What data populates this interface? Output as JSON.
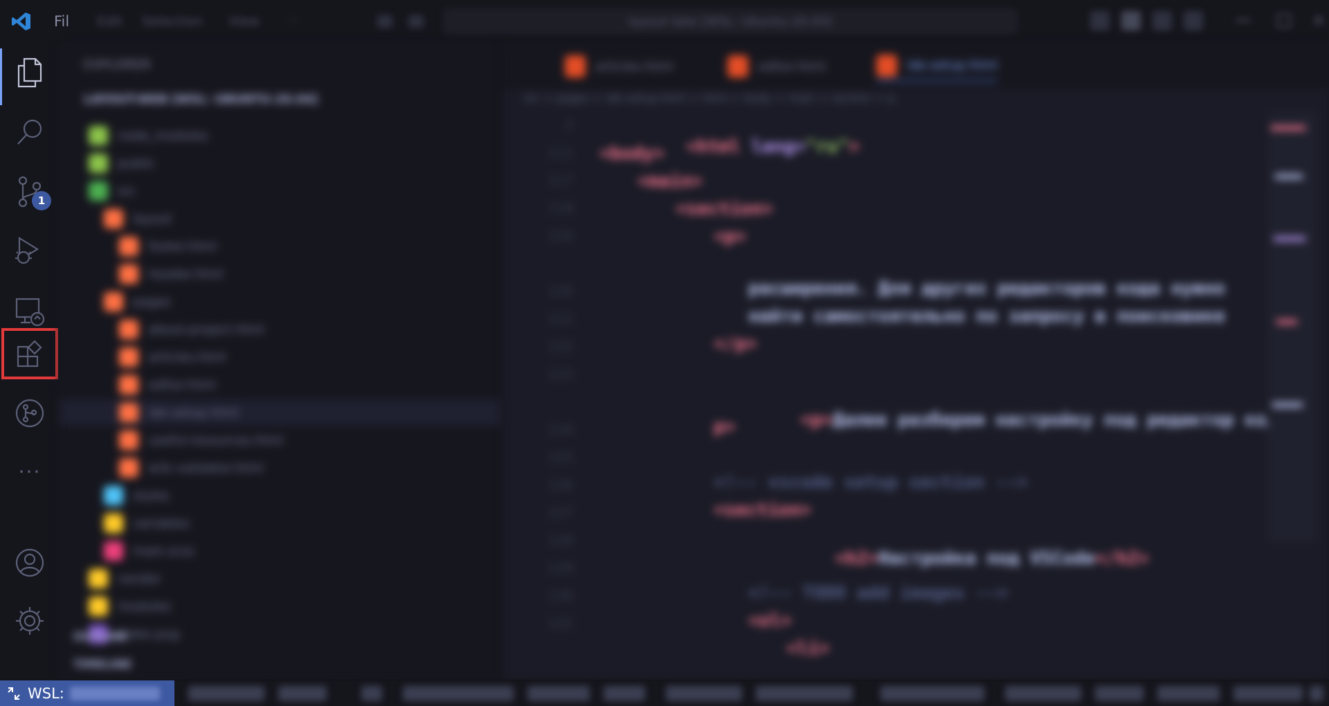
{
  "titlebar": {
    "menu_file": "Fil",
    "menu_edit": "Edit",
    "menu_selection": "Selection",
    "menu_view": "View",
    "menu_more": "···",
    "command_center": "layout-lake [WSL: Ubuntu-20.04]"
  },
  "activitybar": {
    "items": [
      {
        "name": "explorer"
      },
      {
        "name": "search"
      },
      {
        "name": "source-control",
        "badge": "1"
      },
      {
        "name": "run-and-debug"
      },
      {
        "name": "remote-explorer"
      },
      {
        "name": "extensions"
      },
      {
        "name": "git-graph"
      },
      {
        "name": "more"
      }
    ],
    "bottom": [
      {
        "name": "accounts"
      },
      {
        "name": "manage"
      }
    ]
  },
  "sidebar": {
    "title": "EXPLORER",
    "root": "LAYOUT-WEB [WSL: UBUNTU-20.04]",
    "tree": [
      {
        "label": "node_modules",
        "indent": 1,
        "color": "#8bc34a"
      },
      {
        "label": "public",
        "indent": 1,
        "color": "#8bc34a"
      },
      {
        "label": "src",
        "indent": 1,
        "color": "#4caf50"
      },
      {
        "label": "layout",
        "indent": 2,
        "color": "#ff7043"
      },
      {
        "label": "footer.html",
        "indent": 3,
        "color": "#ff7043"
      },
      {
        "label": "header.html",
        "indent": 3,
        "color": "#ff7043"
      },
      {
        "label": "pages",
        "indent": 2,
        "color": "#ff7043"
      },
      {
        "label": "about-project.html",
        "indent": 3,
        "color": "#ff7043"
      },
      {
        "label": "articles.html",
        "indent": 3,
        "color": "#ff7043"
      },
      {
        "label": "editor.html",
        "indent": 3,
        "color": "#ff7043"
      },
      {
        "label": "ide-setup.html",
        "indent": 3,
        "color": "#ff7043",
        "selected": true
      },
      {
        "label": "useful-resources.html",
        "indent": 3,
        "color": "#ff7043"
      },
      {
        "label": "w3c-validator.html",
        "indent": 3,
        "color": "#ff7043"
      },
      {
        "label": "styles",
        "indent": 2,
        "color": "#4fc3f7"
      },
      {
        "label": "variables",
        "indent": 2,
        "color": "#ffca28"
      },
      {
        "label": "main.scss",
        "indent": 2,
        "color": "#ec407a"
      },
      {
        "label": "vendor",
        "indent": 1,
        "color": "#ffca28"
      },
      {
        "label": "modules",
        "indent": 1,
        "color": "#ffca28"
      },
      {
        "label": "index.pug",
        "indent": 1,
        "color": "#7e57c2"
      }
    ],
    "outline": "OUTLINE",
    "timeline": "TIMELINE"
  },
  "editor": {
    "tabs": [
      {
        "label": "articles.html"
      },
      {
        "label": "editor.html"
      },
      {
        "label": "ide-setup.html",
        "active": true
      }
    ],
    "breadcrumbs": "src > pages > ide-setup.html > html > body > main > section > p",
    "line_numbers": [
      "2",
      "111",
      "117",
      "118",
      "119",
      "",
      "120",
      "121",
      "122",
      "123",
      "",
      "124",
      "125",
      "126",
      "127",
      "128",
      "129",
      "130",
      "131"
    ],
    "code": {
      "l1_tag": "<html",
      "l1_attr": " lang=",
      "l1_str": "\"ru\"",
      "l1_end": ">",
      "l2": "<body>",
      "l3": "<main>",
      "l4": "<section>",
      "l5": "<p>",
      "l6": "расширения. Для других редакторов кода нужно",
      "l7": "найти самостоятельно по запросу в поисковике",
      "l8": "</p>",
      "l9_tag": "<p>",
      "l9_text": "Далее разберем настройку под редактор кода",
      "l10": "p>",
      "l11": "<!-- vscode setup section -->",
      "l12": "<section>",
      "l13_open": "<h2>",
      "l13_text": "Настройка под VSCode",
      "l13_close": "</h2>",
      "l14": "<!-- TODO add images -->",
      "l15": "<ol>",
      "l16": "<li>"
    }
  },
  "statusbar": {
    "remote": "WSL:",
    "remote_target": "Ubuntu-20.04",
    "branch": "main*",
    "problems": "0  0",
    "live_share": "Launchpad",
    "git_graph": "Git Graph",
    "mode": "-- NORMAL --",
    "position": "Ln 129, Col 13",
    "tabsize": "Tab Size: 4",
    "encoding": "UTF-8",
    "language": "HTML",
    "version": "2.0.9"
  },
  "colors": {
    "accent": "#3d59a1",
    "highlight_box": "#e23a3a",
    "tag": "#f7768e"
  }
}
